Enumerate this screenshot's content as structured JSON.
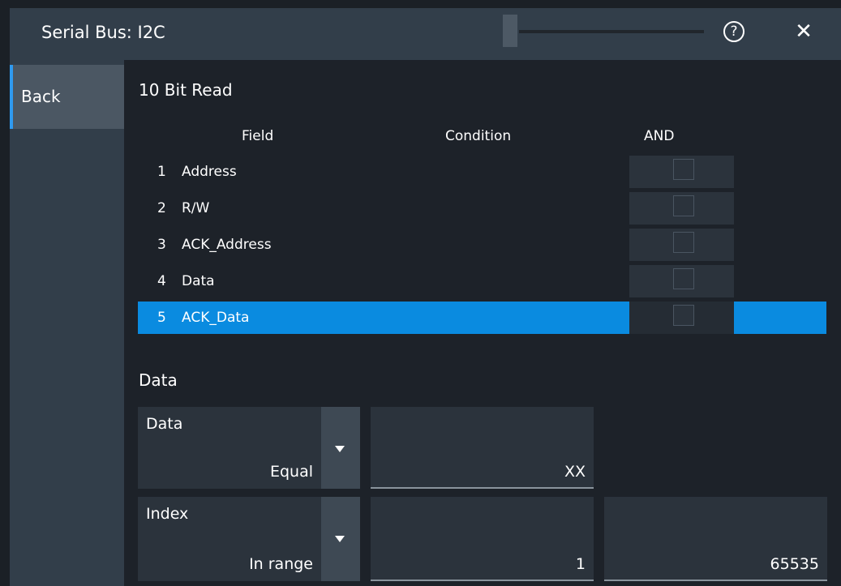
{
  "window": {
    "title": "Serial Bus: I2C",
    "help_label": "?",
    "close_label": "✕"
  },
  "sidebar": {
    "back_label": "Back"
  },
  "frame": {
    "title": "10 Bit Read",
    "columns": {
      "field": "Field",
      "condition": "Condition",
      "and": "AND"
    },
    "rows": [
      {
        "num": "1",
        "name": "Address",
        "and_checked": false,
        "selected": false
      },
      {
        "num": "2",
        "name": "R/W",
        "and_checked": false,
        "selected": false
      },
      {
        "num": "3",
        "name": "ACK_Address",
        "and_checked": false,
        "selected": false
      },
      {
        "num": "4",
        "name": "Data",
        "and_checked": false,
        "selected": true
      },
      {
        "num": "5",
        "name": "ACK_Data",
        "and_checked": false,
        "selected": true
      }
    ]
  },
  "data_section": {
    "title": "Data",
    "data_condition": {
      "label": "Data",
      "value": "Equal",
      "field_value": "XX"
    },
    "index_condition": {
      "label": "Index",
      "value": "In range",
      "min_value": "1",
      "max_value": "65535"
    }
  },
  "colors": {
    "accent": "#0a8be0",
    "titlebar": "#323e4a",
    "background": "#1d2229"
  }
}
